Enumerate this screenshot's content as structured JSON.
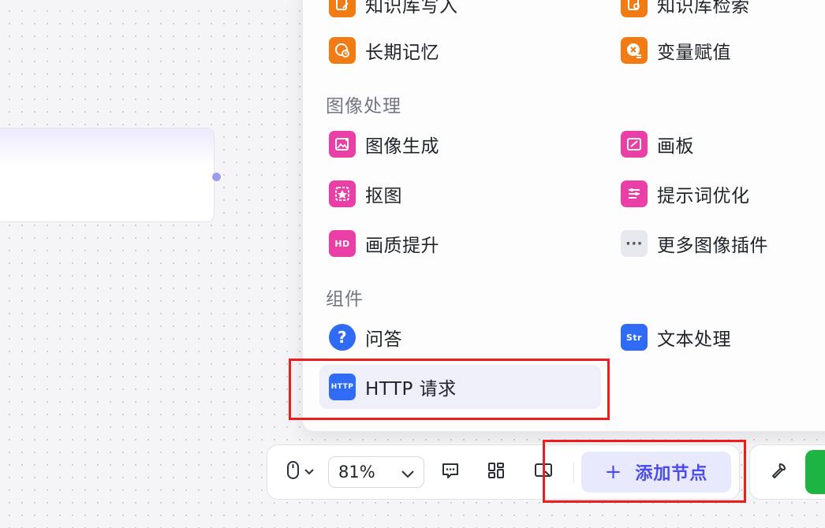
{
  "panel": {
    "rows_top": [
      {
        "label": "知识库写入",
        "icon": "knowledge-write-icon",
        "color": "orange"
      },
      {
        "label": "知识库检索",
        "icon": "knowledge-search-icon",
        "color": "orange"
      },
      {
        "label": "长期记忆",
        "icon": "long-term-memory-icon",
        "color": "orange"
      },
      {
        "label": "变量赋值",
        "icon": "variable-assign-icon",
        "color": "orange"
      }
    ],
    "sections": [
      {
        "title": "图像处理",
        "items": [
          {
            "label": "图像生成",
            "icon": "image-generate-icon"
          },
          {
            "label": "画板",
            "icon": "canvas-board-icon"
          },
          {
            "label": "抠图",
            "icon": "cutout-icon"
          },
          {
            "label": "提示词优化",
            "icon": "prompt-optimize-icon"
          },
          {
            "label": "画质提升",
            "icon": "hd-upscale-icon",
            "glyph": "HD"
          },
          {
            "label": "更多图像插件",
            "icon": "more-icon",
            "glyph": "···"
          }
        ]
      },
      {
        "title": "组件",
        "items": [
          {
            "label": "问答",
            "icon": "question-answer-icon",
            "glyph": "?"
          },
          {
            "label": "文本处理",
            "icon": "text-process-icon",
            "glyph": "Str"
          },
          {
            "label": "HTTP 请求",
            "icon": "http-request-icon",
            "glyph": "HTTP"
          }
        ]
      }
    ]
  },
  "toolbar": {
    "zoom_value": "81%",
    "add_node_label": "添加节点",
    "add_node_glyph": "+"
  },
  "colors": {
    "orange": "#f27c13",
    "pink": "#e93fa6",
    "blue": "#2f6bf5",
    "accent": "#4b4cea",
    "highlight_box": "#ee1c1c",
    "run_green": "#1db441"
  }
}
